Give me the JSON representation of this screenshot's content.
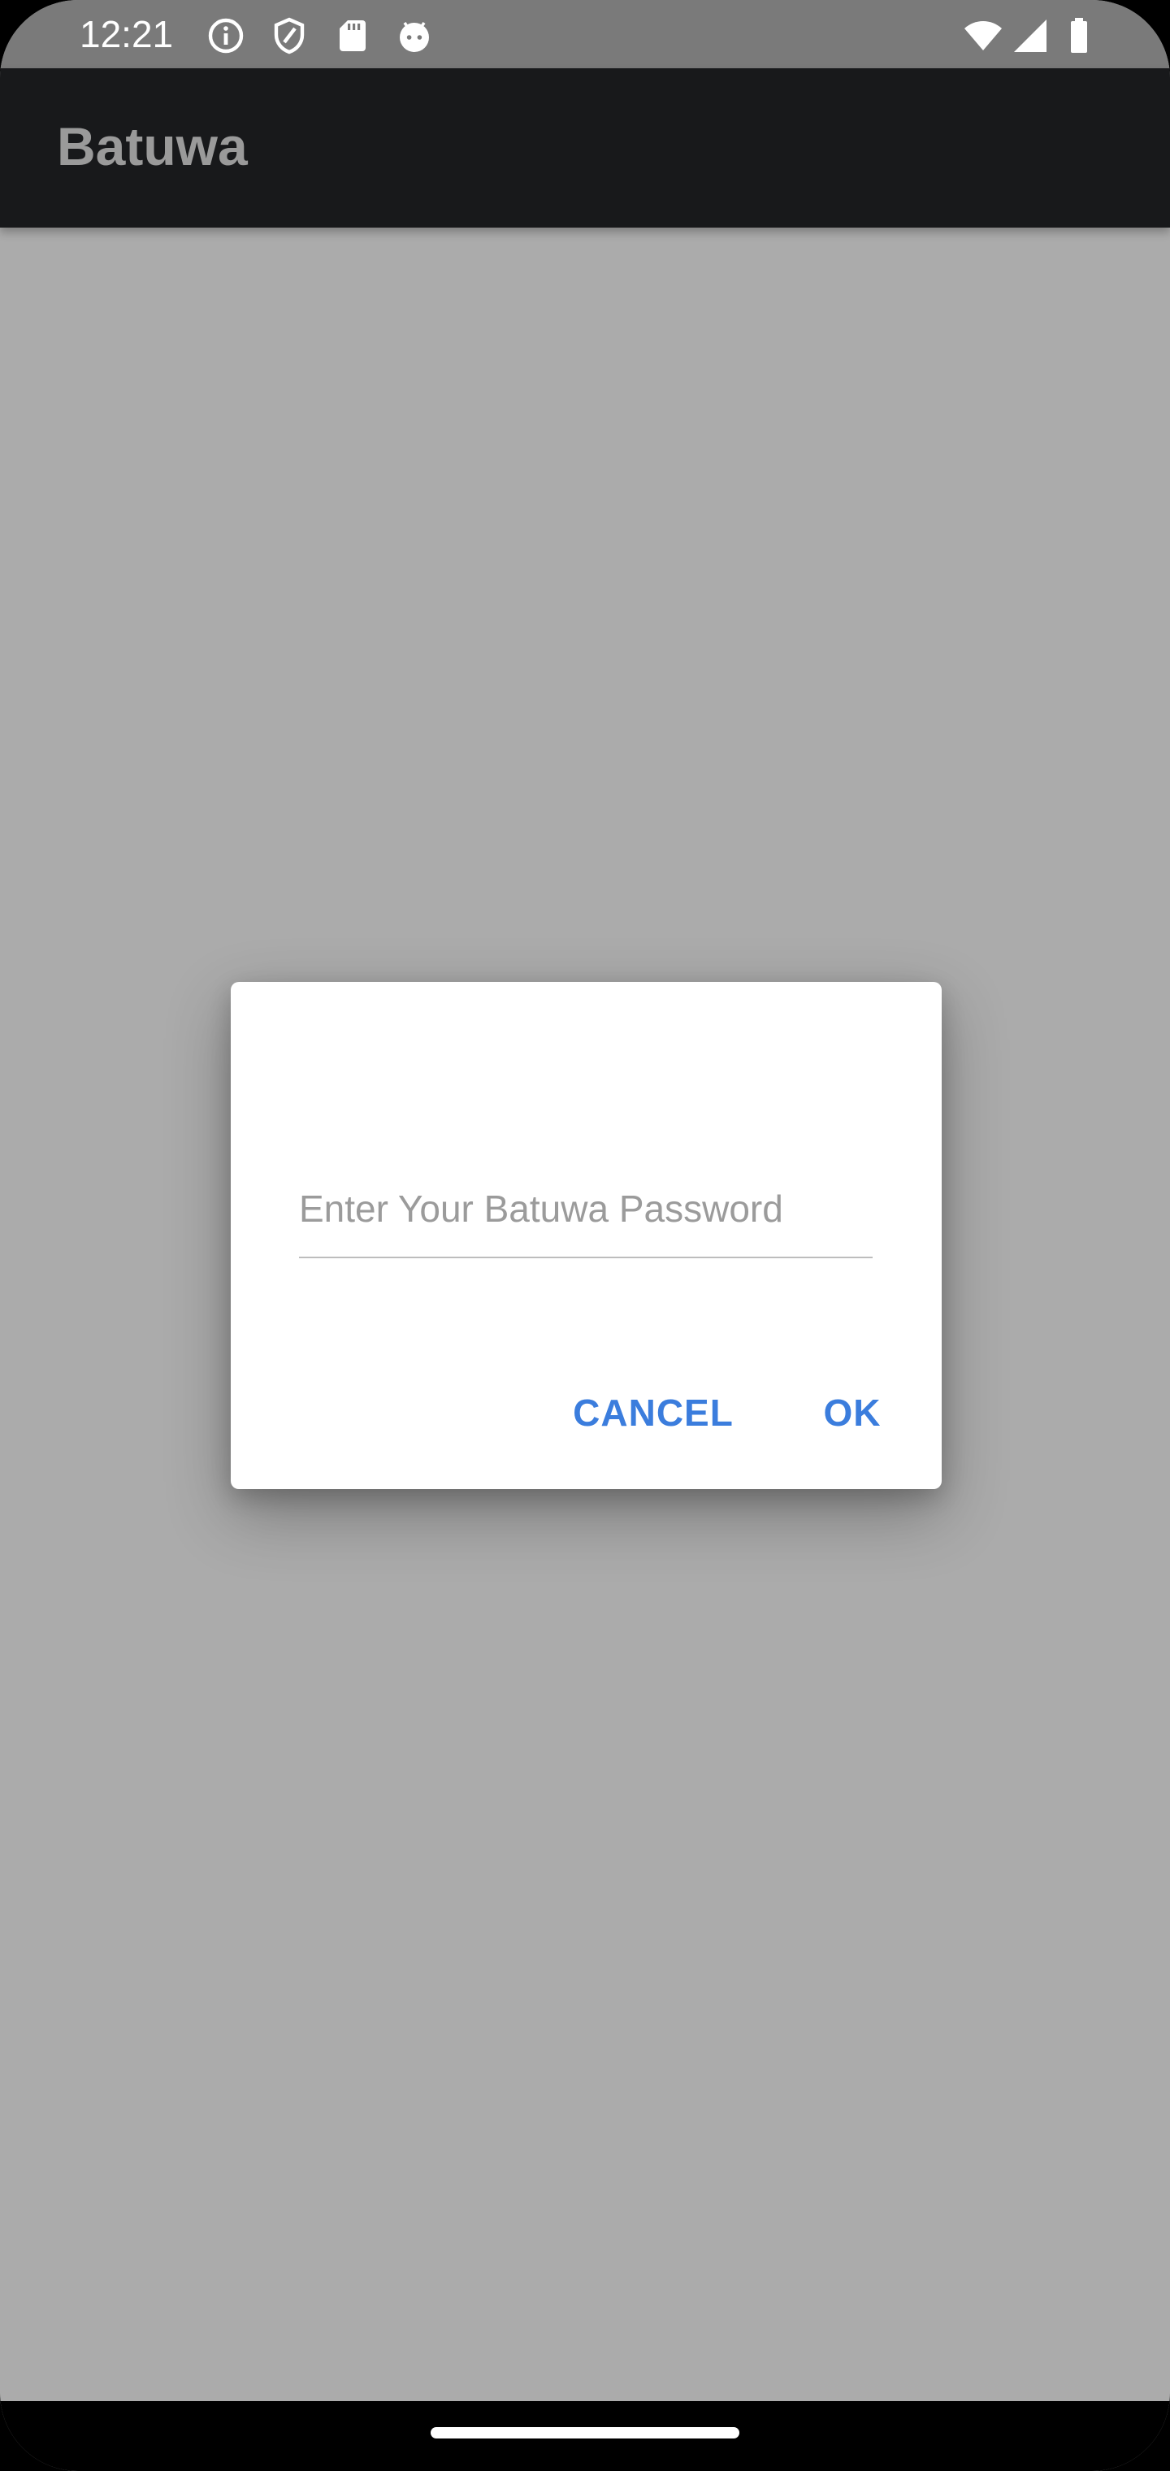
{
  "status_bar": {
    "time": "12:21",
    "left_icons": [
      "info-icon",
      "shield-icon",
      "sd-card-icon",
      "android-icon"
    ],
    "right_icons": [
      "wifi-icon",
      "signal-icon",
      "battery-icon"
    ]
  },
  "app_bar": {
    "title": "Batuwa"
  },
  "dialog": {
    "password_field": {
      "value": "",
      "placeholder": "Enter Your Batuwa Password"
    },
    "cancel_label": "CANCEL",
    "ok_label": "OK"
  },
  "colors": {
    "accent": "#3b7ddd",
    "scrim": "#ababab",
    "app_bar": "#18191b"
  }
}
